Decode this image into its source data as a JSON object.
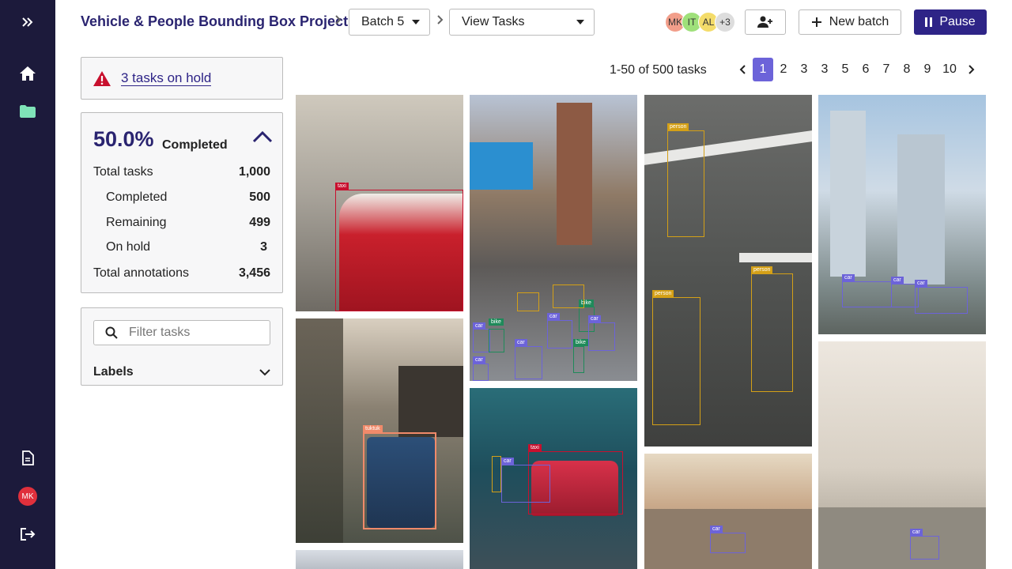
{
  "project": {
    "title": "Vehicle & People Bounding Box Project",
    "batch": "Batch 5",
    "view": "View Tasks"
  },
  "users": [
    "MK",
    "IT",
    "AL",
    "+3"
  ],
  "actions": {
    "new_batch": "New batch",
    "pause": "Pause"
  },
  "sidebar_rail": {
    "user_avatar": "MK"
  },
  "hold": {
    "text": "3 tasks on hold"
  },
  "stats": {
    "percent": "50.0%",
    "percent_label": "Completed",
    "rows": [
      {
        "label": "Total tasks",
        "value": "1,000"
      },
      {
        "label": "Completed",
        "value": "500"
      },
      {
        "label": "Remaining",
        "value": "499"
      },
      {
        "label": "On hold",
        "value": "3"
      },
      {
        "label": "Total annotations",
        "value": "3,456"
      }
    ]
  },
  "filter": {
    "placeholder": "Filter tasks",
    "labels": "Labels"
  },
  "pagination": {
    "info": "1-50 of 500 tasks",
    "pages": [
      "1",
      "2",
      "3",
      "3",
      "5",
      "6",
      "7",
      "8",
      "9",
      "10"
    ],
    "active": "1"
  },
  "annotation_labels": {
    "taxi": "taxi",
    "car": "car",
    "bike": "bike",
    "person": "person",
    "tuktuk": "tuktuk"
  },
  "colors": {
    "rail": "#1c1a3b",
    "primary": "#2e2487",
    "accent": "#6c63d9",
    "taxi": "#c8102e",
    "car": "#6c63d9",
    "bike": "#1f8a5a",
    "person": "#d4a017",
    "tuktuk": "#f08a6a"
  }
}
